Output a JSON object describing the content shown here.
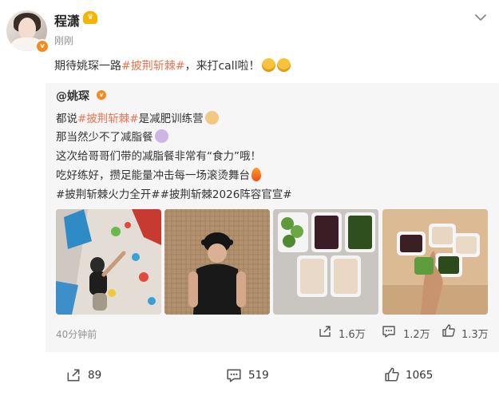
{
  "post": {
    "author": "程潇",
    "time": "刚刚",
    "text_before": "期待姚琛一路",
    "tag": "#披荆斩棘#",
    "text_after": "，来打call啦！"
  },
  "repost": {
    "author": "@姚琛",
    "line1_before": "都说",
    "line1_tag": "#披荆斩棘#",
    "line1_after": "是减肥训练营",
    "line2": "那当然少不了减脂餐",
    "line3": "这次给哥哥们带的减脂餐非常有“食力”哦！",
    "line4": "吃好练好，攒足能量冲击每一场滚烫舞台",
    "tags": "#披荆斩棘火力全开##披荆斩棘2026阵容官宣#",
    "time": "40分钟前",
    "repost_count": "1.6万",
    "comment_count": "1.2万",
    "like_count": "1.3万"
  },
  "actions": {
    "repost_count": "89",
    "comment_count": "519",
    "like_count": "1065"
  },
  "colors": {
    "tag": "#eb7350",
    "verified": "#f78a1b",
    "repost_bg": "#f6f6f6"
  },
  "icons": [
    "chevron-down-icon",
    "verified-icon",
    "crown-badge-icon",
    "repost-icon",
    "comment-icon",
    "like-icon"
  ]
}
